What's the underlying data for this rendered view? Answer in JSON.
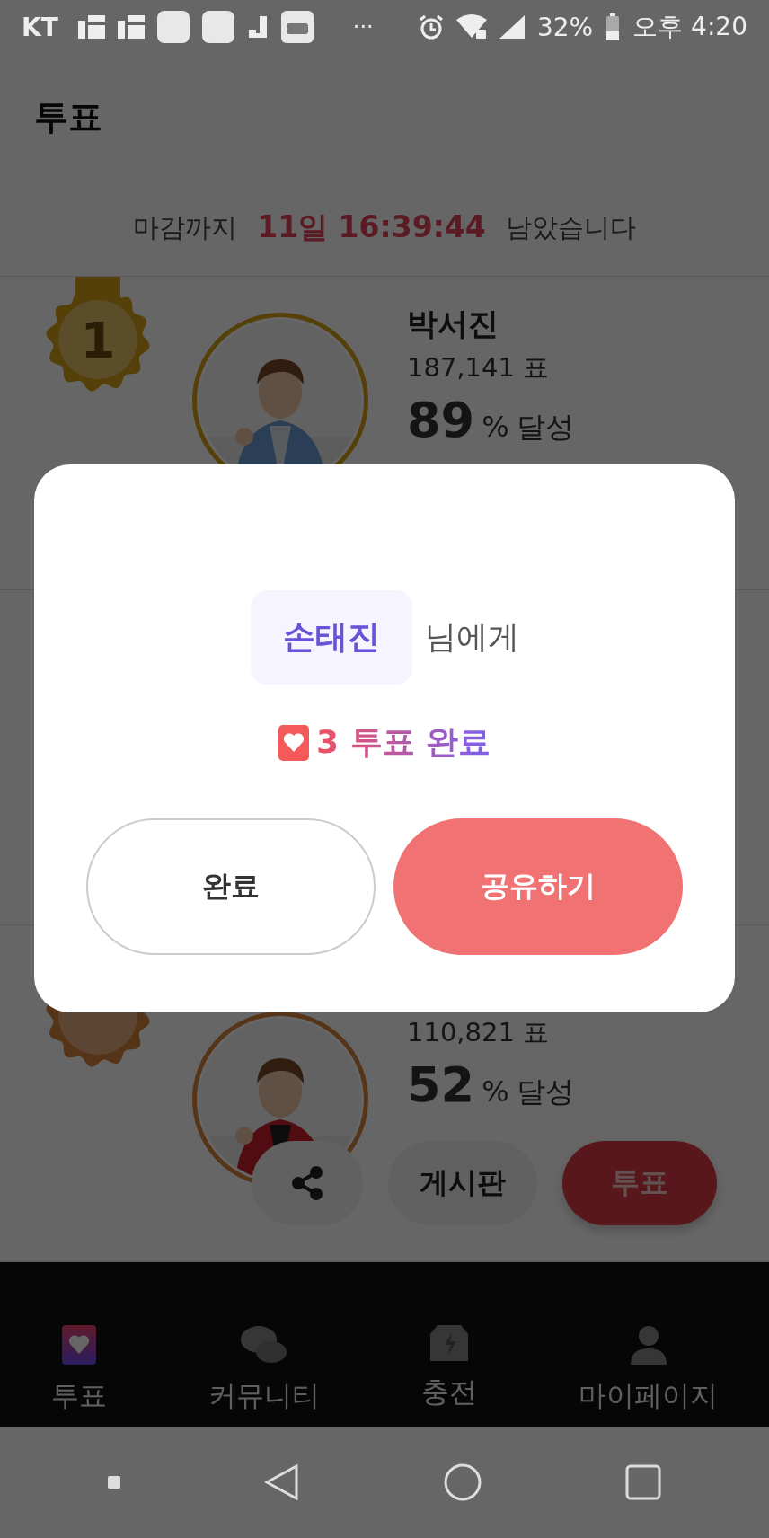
{
  "status_bar": {
    "carrier": "KT",
    "more": "···",
    "battery": "32%",
    "time": "오후 4:20"
  },
  "header": {
    "title": "투표"
  },
  "deadline": {
    "prefix": "마감까지",
    "remaining": "11일 16:39:44",
    "suffix": "남았습니다"
  },
  "rankings": [
    {
      "rank": "1",
      "name": "박서진",
      "votes": "187,141 표",
      "percent": "89",
      "percent_unit": "%",
      "achieved": "달성"
    },
    {
      "votes": "110,821 표",
      "percent": "52",
      "percent_unit": "%",
      "achieved": "달성",
      "actions": [
        {
          "kind": "share"
        },
        {
          "kind": "board",
          "label": "게시판"
        },
        {
          "kind": "vote",
          "label": "투표"
        }
      ]
    }
  ],
  "bottom_nav": [
    {
      "kind": "vote",
      "label": "투표",
      "selected": true
    },
    {
      "kind": "community",
      "label": "커뮤니티",
      "selected": false
    },
    {
      "kind": "charge",
      "label": "충전",
      "selected": false
    },
    {
      "kind": "mypage",
      "label": "마이페이지",
      "selected": false
    }
  ],
  "modal": {
    "recipient": "손태진",
    "recipient_suffix": "님에게",
    "count": "3",
    "result": "투표 완료",
    "buttons": [
      {
        "kind": "secondary",
        "label": "완료"
      },
      {
        "kind": "primary",
        "label": "공유하기"
      }
    ]
  }
}
